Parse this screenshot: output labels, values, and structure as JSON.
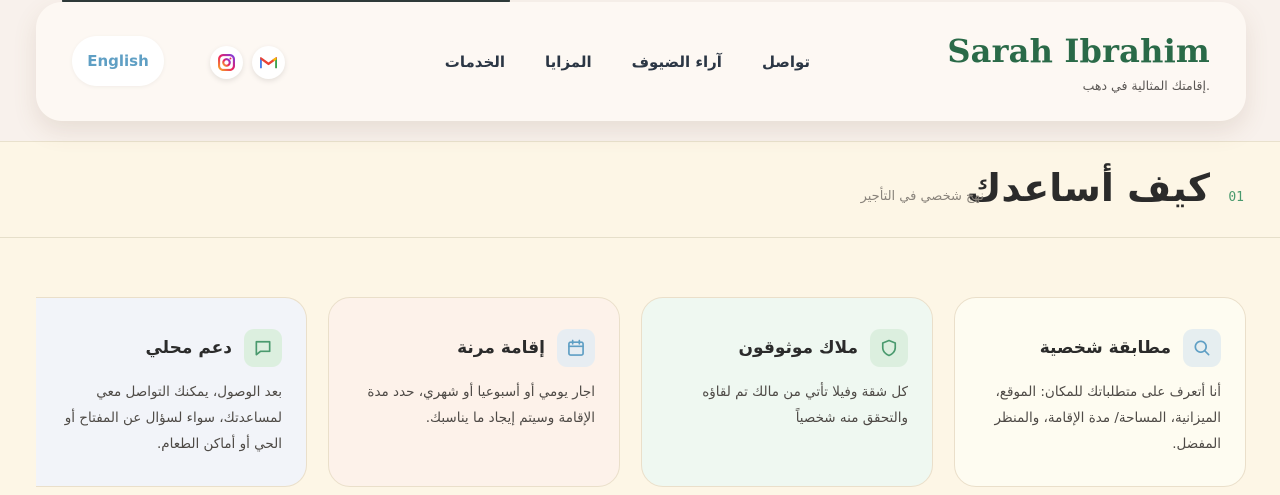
{
  "header": {
    "brand_name": "Sarah Ibrahim",
    "brand_tagline": "إقامتك المثالية في دهب.",
    "nav": [
      "الخدمات",
      "المزايا",
      "آراء الضيوف",
      "تواصل"
    ],
    "lang_button": "English",
    "social_icons": [
      "gmail-icon",
      "instagram-icon"
    ]
  },
  "section": {
    "number": "01",
    "title": "كيف أساعدك",
    "subtitle": "نهج شخصي في التأجير"
  },
  "cards": [
    {
      "title": "مطابقة شخصية",
      "body": "أنا أتعرف على متطلباتك للمكان: الموقع، الميزانية، المساحة/ مدة الإقامة، والمنظر المفضل.",
      "icon": "search-icon",
      "icon_color": "#5f9fc4"
    },
    {
      "title": "ملاك موثوقون",
      "body": "كل شقة وفيلا تأتي من مالك تم لقاؤه والتحقق منه شخصياً",
      "icon": "shield-icon",
      "icon_color": "#4a9a6e"
    },
    {
      "title": "إقامة مرنة",
      "body": "اجار يومي أو أسبوعيا أو شهري، حدد مدة الإقامة وسيتم إيجاد ما يناسبك.",
      "icon": "calendar-icon",
      "icon_color": "#5f9fc4"
    },
    {
      "title": "دعم محلي",
      "body": "بعد الوصول، يمكنك التواصل معي لمساعدتك، سواء لسؤال عن المفتاح أو الحي أو أماكن الطعام.",
      "icon": "chat-icon",
      "icon_color": "#4a9a6e"
    }
  ],
  "colors": {
    "brand_green": "#2a6a48",
    "accent_blue": "#5f9fc4",
    "page_background": "#fdf6e6"
  }
}
